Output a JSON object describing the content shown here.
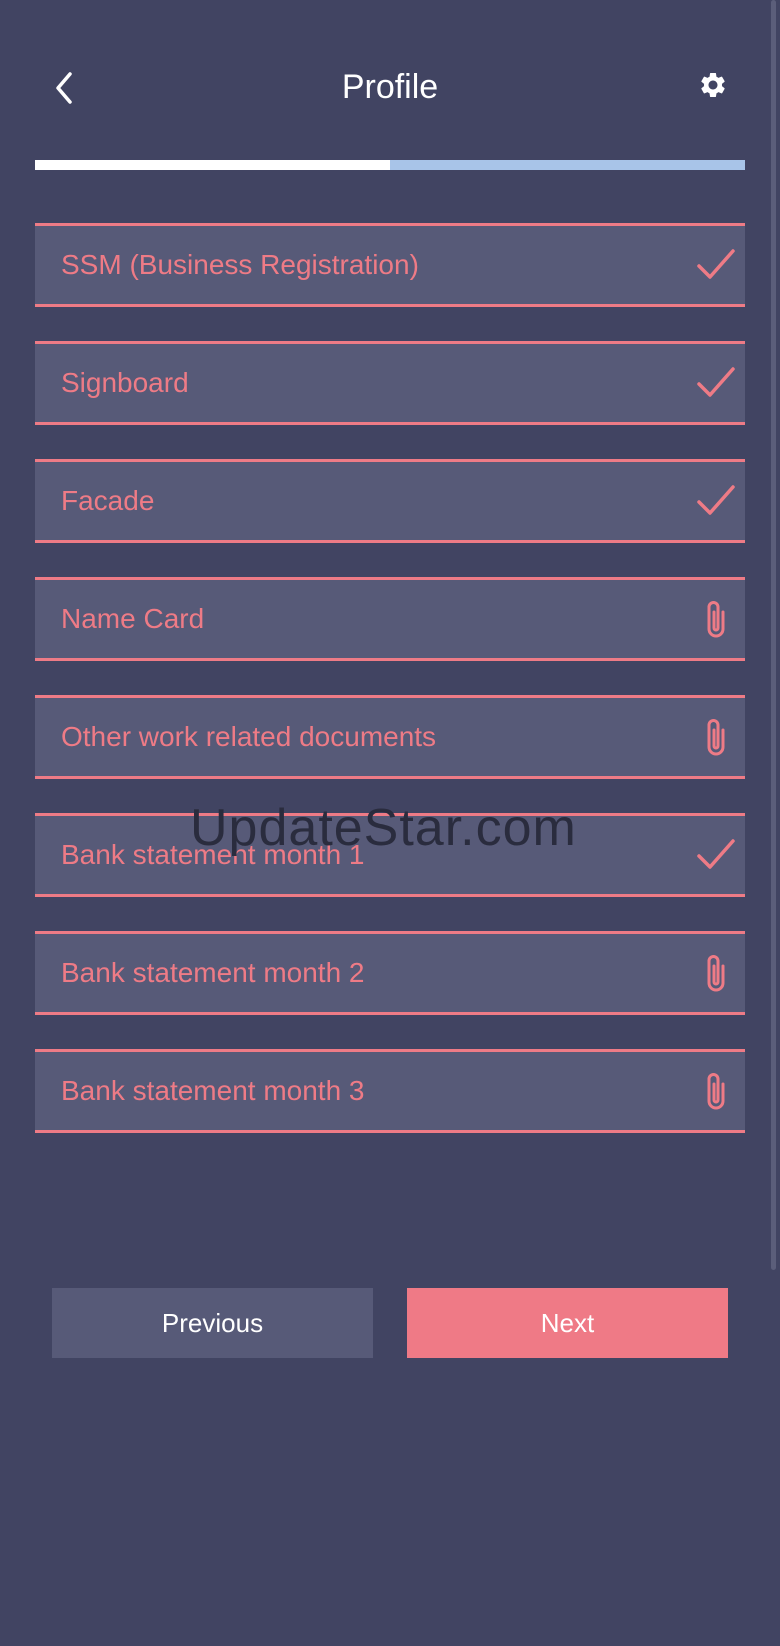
{
  "header": {
    "title": "Profile",
    "back_icon": "chevron-left-icon",
    "settings_icon": "gear-icon"
  },
  "progress": {
    "value": 0.5,
    "fill_color": "#ffffff",
    "track_color": "#a8c4e8"
  },
  "documents": [
    {
      "label": "SSM (Business Registration)",
      "status": "uploaded",
      "icon": "check-icon"
    },
    {
      "label": "Signboard",
      "status": "uploaded",
      "icon": "check-icon"
    },
    {
      "label": "Facade",
      "status": "uploaded",
      "icon": "check-icon"
    },
    {
      "label": "Name Card",
      "status": "pending",
      "icon": "paperclip-icon"
    },
    {
      "label": "Other work related documents",
      "status": "pending",
      "icon": "paperclip-icon"
    },
    {
      "label": "Bank statement month 1",
      "status": "uploaded",
      "icon": "check-icon"
    },
    {
      "label": "Bank statement month 2",
      "status": "pending",
      "icon": "paperclip-icon"
    },
    {
      "label": "Bank statement month 3",
      "status": "pending",
      "icon": "paperclip-icon"
    }
  ],
  "watermark": "UpdateStar.com",
  "buttons": {
    "previous_label": "Previous",
    "next_label": "Next"
  },
  "colors": {
    "background": "#414462",
    "accent": "#ee7b86",
    "card": "#575a78"
  }
}
